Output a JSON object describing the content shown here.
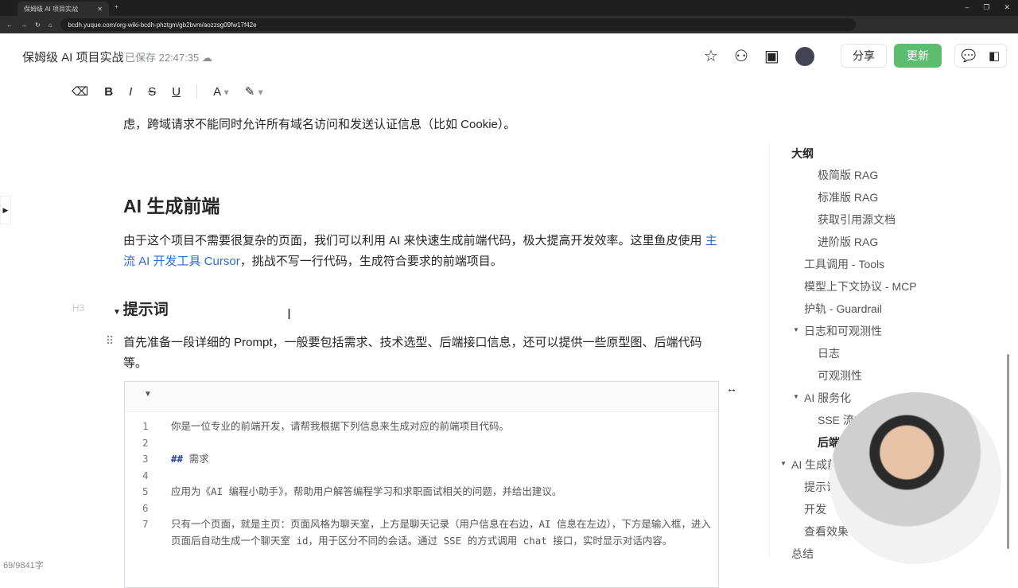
{
  "browser": {
    "tab_title": "保姆级 AI 项目实战",
    "url": "bcdh.yuque.com/org-wiki-bcdh-phztgm/gb2bvm/aozzsg09fw17f42e"
  },
  "header": {
    "title": "保姆级 AI 项目实战",
    "saved": "已保存 22:47:35",
    "share": "分享",
    "update": "更新"
  },
  "toolbar": [
    "clear-format",
    "B",
    "I",
    "S",
    "U",
    "A",
    "highlight"
  ],
  "doc": {
    "p1": "虑，跨域请求不能同时允许所有域名访问和发送认证信息（比如 Cookie）。",
    "h2": "AI 生成前端",
    "p2_a": "由于这个项目不需要很复杂的页面，我们可以利用 AI 来快速生成前端代码，极大提高开发效率。这里鱼皮使用 ",
    "p2_link": "主流 AI 开发工具 Cursor",
    "p2_b": "，挑战不写一行代码，生成符合要求的前端项目。",
    "h3_mark": "H3",
    "h3": "提示词",
    "p3": "首先准备一段详细的 Prompt，一般要包括需求、技术选型、后端接口信息，还可以提供一些原型图、后端代码等。",
    "code": [
      {
        "n": "1",
        "t": "你是一位专业的前端开发，请帮我根据下列信息来生成对应的前端项目代码。"
      },
      {
        "n": "2",
        "t": ""
      },
      {
        "n": "3",
        "kw": "##",
        "t": " 需求"
      },
      {
        "n": "4",
        "t": ""
      },
      {
        "n": "5",
        "t": "应用为《AI 编程小助手》，帮助用户解答编程学习和求职面试相关的问题，并给出建议。"
      },
      {
        "n": "6",
        "t": ""
      },
      {
        "n": "7",
        "t": "只有一个页面，就是主页：页面风格为聊天室，上方是聊天记录（用户信息在右边，AI 信息在左边），下方是输入框，进入页面后自动生成一个聊天室 id，用于区分不同的会话。通过 SSE 的方式调用 chat 接口，实时显示对话内容。"
      }
    ]
  },
  "outline": {
    "title": "大纲",
    "items": [
      {
        "label": "极简版 RAG",
        "level": 2
      },
      {
        "label": "标准版 RAG",
        "level": 2
      },
      {
        "label": "获取引用源文档",
        "level": 2
      },
      {
        "label": "进阶版 RAG",
        "level": 2
      },
      {
        "label": "工具调用 - Tools",
        "level": 1
      },
      {
        "label": "模型上下文协议 - MCP",
        "level": 1
      },
      {
        "label": "护轨 - Guardrail",
        "level": 1
      },
      {
        "label": "日志和可观测性",
        "level": 1,
        "caret": true
      },
      {
        "label": "日志",
        "level": 2
      },
      {
        "label": "可观测性",
        "level": 2
      },
      {
        "label": "AI 服务化",
        "level": 1,
        "caret": true
      },
      {
        "label": "SSE 流式",
        "level": 2
      },
      {
        "label": "后端",
        "level": 2,
        "active": true
      },
      {
        "label": "AI 生成前端",
        "level": 0,
        "caret": true
      },
      {
        "label": "提示词",
        "level": 1
      },
      {
        "label": "开发",
        "level": 1
      },
      {
        "label": "查看效果",
        "level": 1
      },
      {
        "label": "总结",
        "level": 0
      }
    ]
  },
  "word_count": "69/9841字"
}
